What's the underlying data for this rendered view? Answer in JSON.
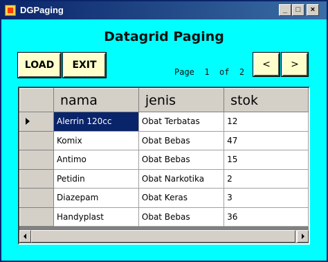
{
  "window": {
    "title": "DGPaging",
    "caption_buttons": {
      "minimize": "_",
      "maximize": "□",
      "close": "×"
    }
  },
  "heading": "Datagrid Paging",
  "toolbar": {
    "load_label": "LOAD",
    "exit_label": "EXIT",
    "prev_label": "<",
    "next_label": ">"
  },
  "pager": {
    "text": "Page  1  of  2",
    "current_page": 1,
    "total_pages": 2
  },
  "grid": {
    "columns": [
      "nama",
      "jenis",
      "stok"
    ],
    "rows": [
      {
        "nama": "Alerrin 120cc",
        "jenis": "Obat Terbatas",
        "stok": "12"
      },
      {
        "nama": "Komix",
        "jenis": "Obat Bebas",
        "stok": "47"
      },
      {
        "nama": "Antimo",
        "jenis": "Obat Bebas",
        "stok": "15"
      },
      {
        "nama": "Petidin",
        "jenis": "Obat Narkotika",
        "stok": "2"
      },
      {
        "nama": "Diazepam",
        "jenis": "Obat Keras",
        "stok": "3"
      },
      {
        "nama": "Handyplast",
        "jenis": "Obat Bebas",
        "stok": "36"
      }
    ],
    "selected_row": 0
  },
  "colors": {
    "form_background": "#00ffff",
    "button_background": "#ffffcc",
    "selection": "#0a246a",
    "titlebar_start": "#0a246a",
    "titlebar_end": "#3a6ea5"
  }
}
